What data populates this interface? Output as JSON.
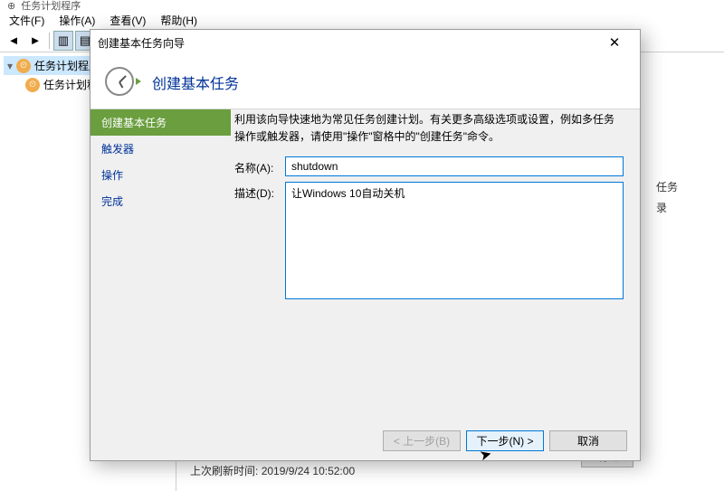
{
  "bg": {
    "title": "任务计划程序",
    "menu": {
      "file": "文件(F)",
      "action": "操作(A)",
      "view": "查看(V)",
      "help": "帮助(H)"
    },
    "tree": {
      "root": "任务计划程序 (本地",
      "lib": "任务计划程序库"
    },
    "actions": {
      "col1": "任务",
      "col2": "录"
    },
    "bottom": {
      "label": "上次刷新时间:",
      "time": "2019/9/24 10:52:00",
      "refresh": "刷新"
    }
  },
  "wizard": {
    "title": "创建基本任务向导",
    "header": "创建基本任务",
    "steps": {
      "s1": "创建基本任务",
      "s2": "触发器",
      "s3": "操作",
      "s4": "完成"
    },
    "intro": "利用该向导快速地为常见任务创建计划。有关更多高级选项或设置，例如多任务操作或触发器，请使用\"操作\"窗格中的\"创建任务\"命令。",
    "name_label": "名称(A):",
    "name_value": "shutdown",
    "desc_label": "描述(D):",
    "desc_value": "让Windows 10自动关机",
    "buttons": {
      "back": "< 上一步(B)",
      "next": "下一步(N) >",
      "cancel": "取消"
    }
  }
}
